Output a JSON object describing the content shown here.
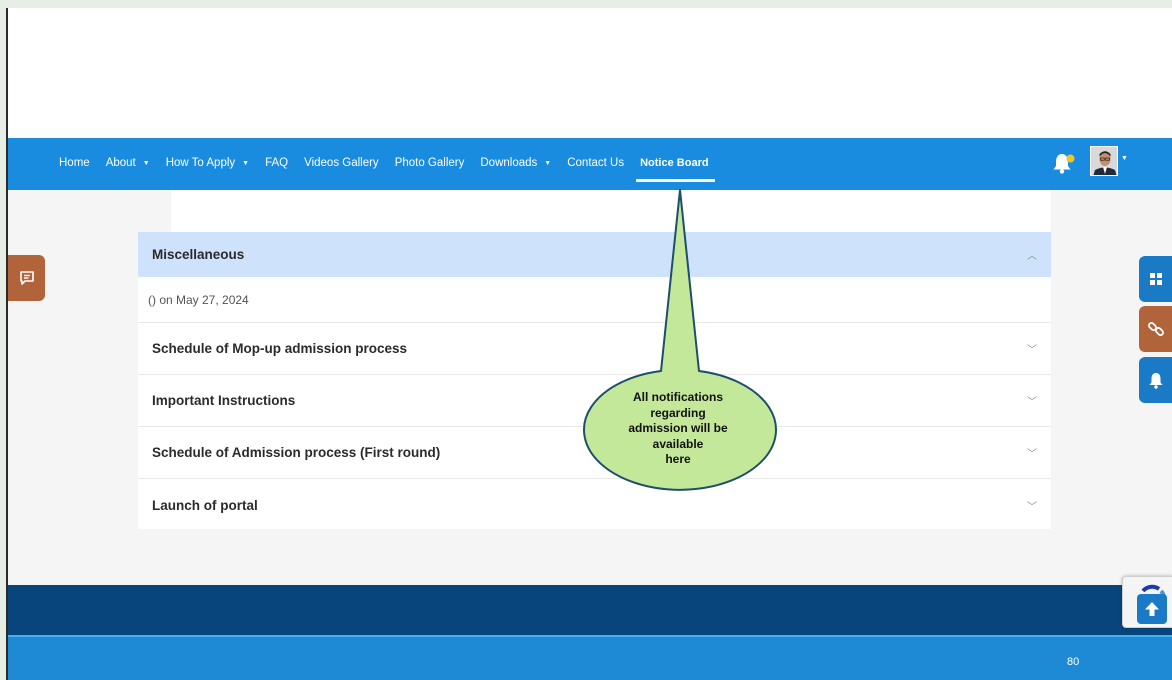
{
  "nav": {
    "items": [
      {
        "label": "Home",
        "dropdown": false
      },
      {
        "label": "About",
        "dropdown": true
      },
      {
        "label": "How To Apply",
        "dropdown": true
      },
      {
        "label": "FAQ",
        "dropdown": false
      },
      {
        "label": "Videos Gallery",
        "dropdown": false
      },
      {
        "label": "Photo Gallery",
        "dropdown": false
      },
      {
        "label": "Downloads",
        "dropdown": true
      },
      {
        "label": "Contact Us",
        "dropdown": false
      },
      {
        "label": "Notice Board",
        "dropdown": false,
        "active": true
      }
    ],
    "dropdown_caret": "▼"
  },
  "notice_board": {
    "category_title": "Miscellaneous",
    "category_meta": "() on May 27, 2024",
    "notices": [
      {
        "title": "Schedule of Mop-up admission process"
      },
      {
        "title": "Important Instructions"
      },
      {
        "title": "Schedule of Admission process (First round)"
      },
      {
        "title": "Launch of portal"
      }
    ]
  },
  "callout": {
    "lines": [
      "All notifications",
      "regarding",
      "admission will be",
      "available",
      "here"
    ]
  },
  "footer": {
    "page_number": "80"
  },
  "icons": {
    "notification": "bell-icon",
    "feedback": "chat-icon",
    "dashboard": "grid-icon",
    "links": "link-icon",
    "side_notification": "bell-icon",
    "scroll_top": "arrow-up-icon"
  },
  "colors": {
    "navbar": "#1a8ce0",
    "accordion_header": "#cfe2fb",
    "callout_fill": "#c4e89a",
    "feedback_tab": "#b1633a",
    "footer_dark": "#08457c",
    "footer_light": "#1e8ad6"
  }
}
